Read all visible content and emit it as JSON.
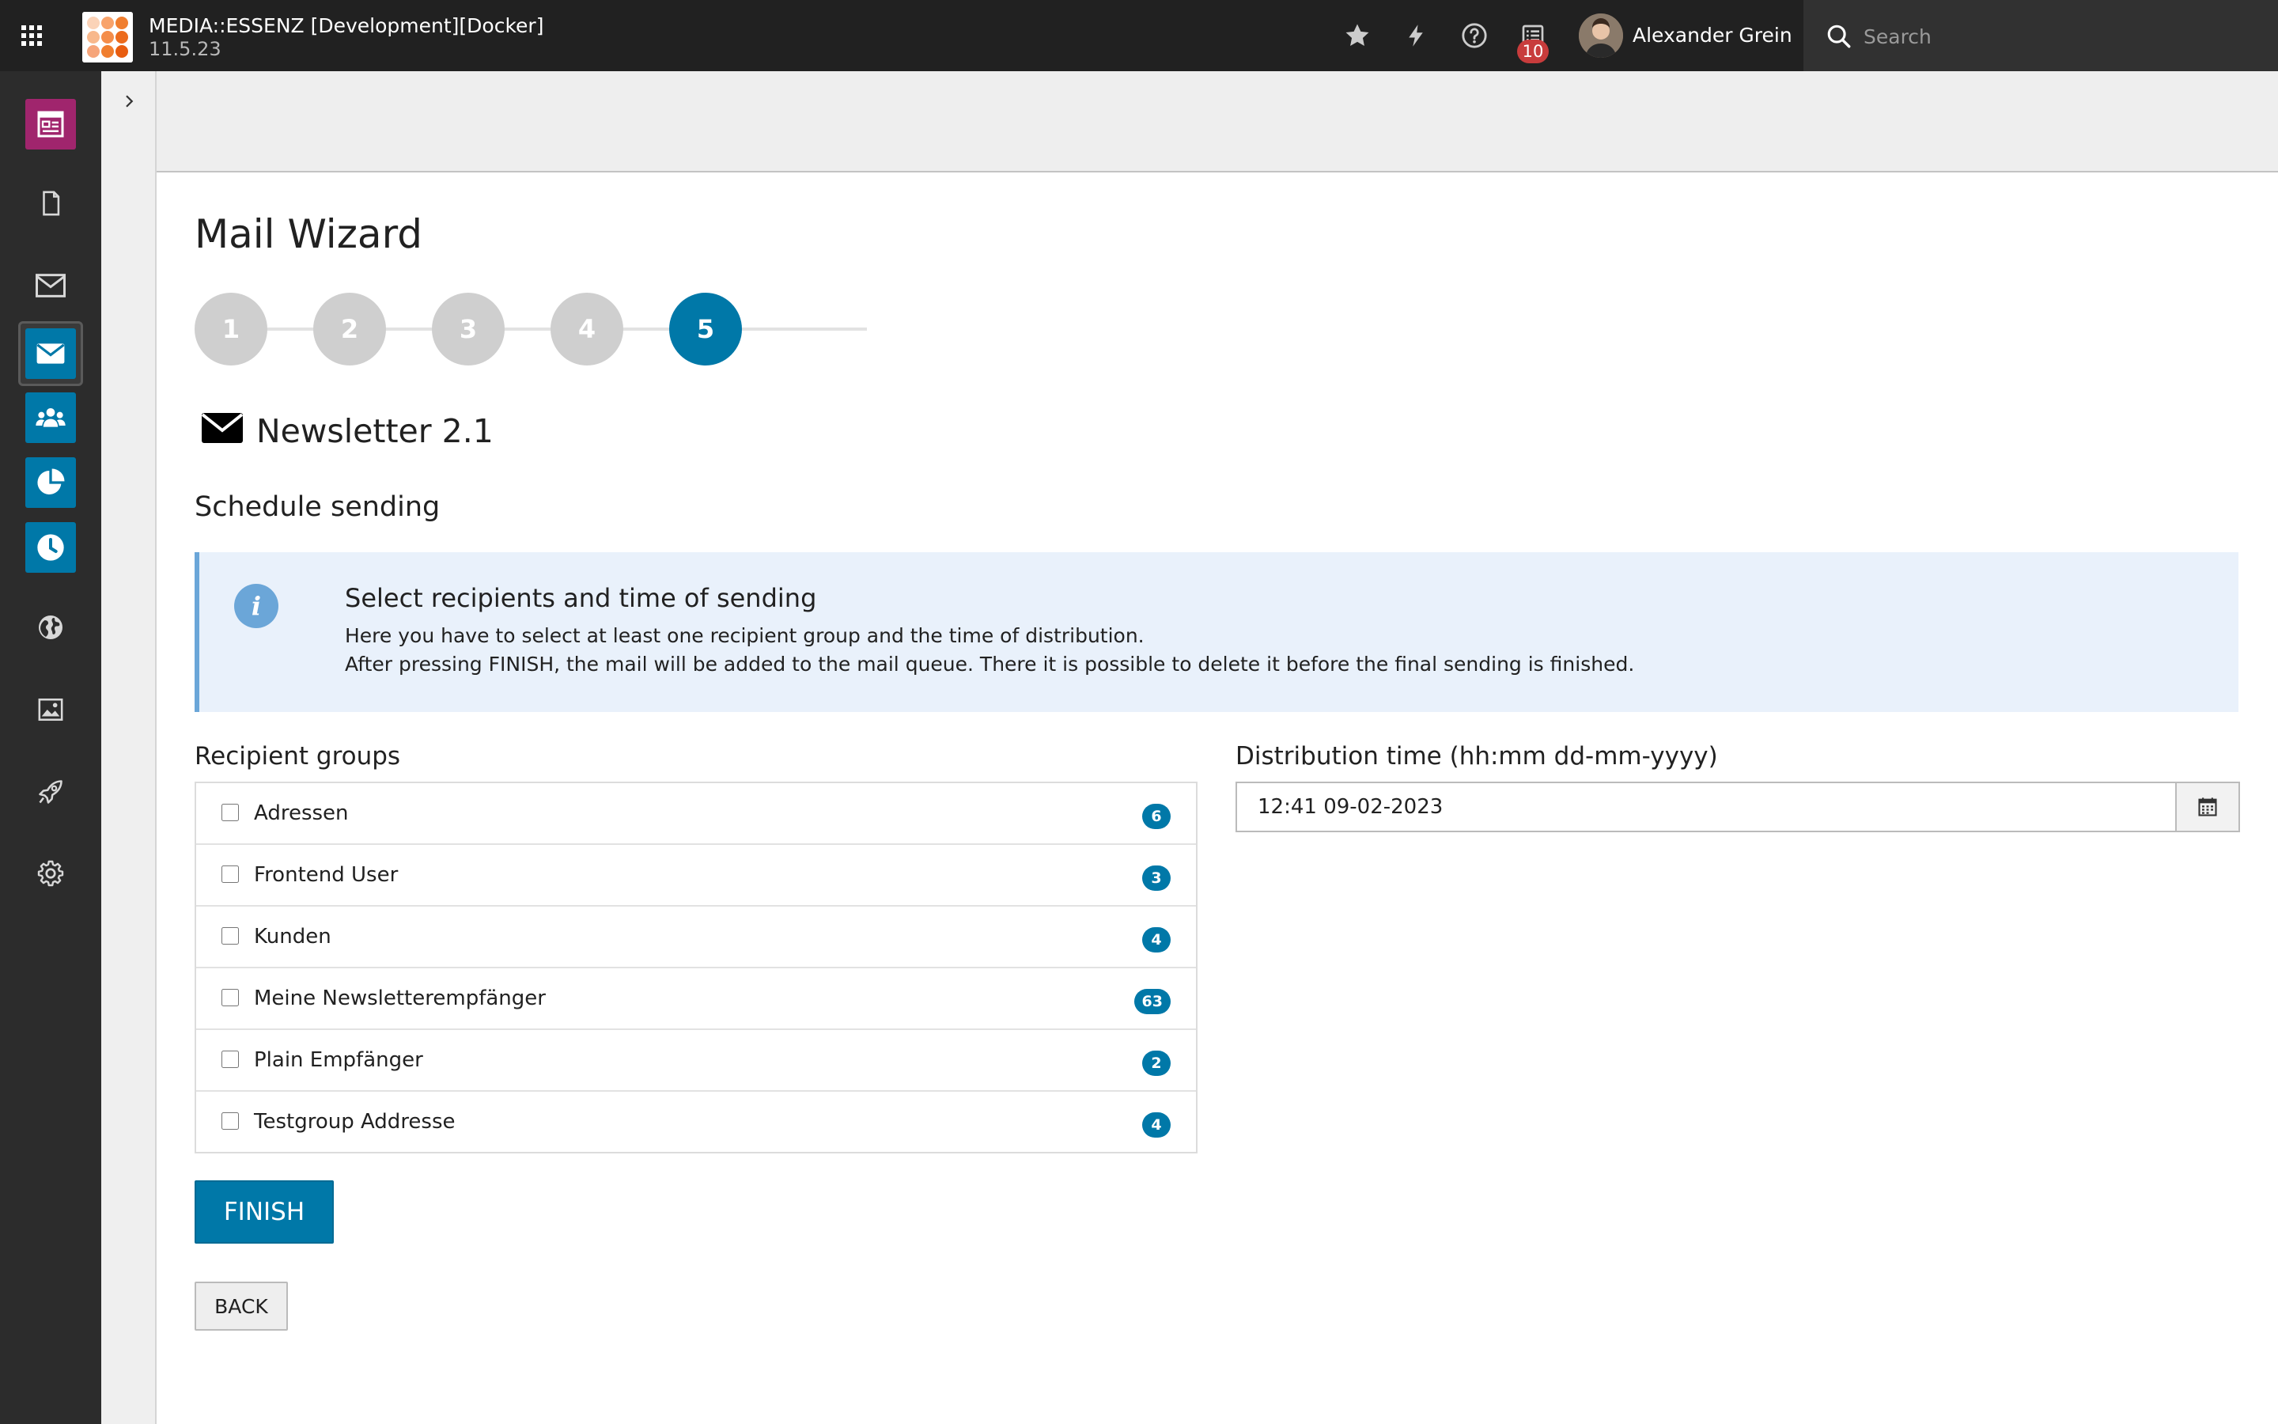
{
  "topbar": {
    "site_name": "MEDIA::ESSENZ [Development][Docker]",
    "version": "11.5.23",
    "notification_count": "10",
    "user_name": "Alexander Grein",
    "search_placeholder": "Search",
    "icons": [
      "app-grid-icon",
      "star-icon",
      "lightning-icon",
      "help-icon",
      "system-info-icon",
      "search-icon"
    ]
  },
  "module_menu": {
    "items": [
      {
        "name": "web-layout-module",
        "color": "#a0256d",
        "active": false
      },
      {
        "name": "page-module",
        "active": false
      },
      {
        "name": "mail-module",
        "active": false
      },
      {
        "name": "mail-wizard-module",
        "color": "#0078a8",
        "active": true
      },
      {
        "name": "recipients-module",
        "color": "#0078a8",
        "active": false
      },
      {
        "name": "report-module",
        "color": "#0078a8",
        "active": false
      },
      {
        "name": "queue-module",
        "color": "#0078a8",
        "active": false
      },
      {
        "name": "globe-module",
        "active": false
      },
      {
        "name": "filelist-module",
        "active": false
      },
      {
        "name": "rocket-module",
        "active": false
      },
      {
        "name": "settings-module",
        "active": false
      }
    ]
  },
  "wizard": {
    "title": "Mail Wizard",
    "steps": [
      "1",
      "2",
      "3",
      "4",
      "5"
    ],
    "current_step": 5,
    "newsletter_title": "Newsletter 2.1",
    "section_title": "Schedule sending",
    "callout": {
      "title": "Select recipients and time of sending",
      "line1": "Here you have to select at least one recipient group and the time of distribution.",
      "line2": "After pressing FINISH, the mail will be added to the mail queue. There it is possible to delete it before the final sending is finished."
    },
    "recipient_groups_label": "Recipient groups",
    "groups": [
      {
        "name": "Adressen",
        "count": "6",
        "checked": false
      },
      {
        "name": "Frontend User",
        "count": "3",
        "checked": false
      },
      {
        "name": "Kunden",
        "count": "4",
        "checked": false
      },
      {
        "name": "Meine Newsletterempfänger",
        "count": "63",
        "checked": false
      },
      {
        "name": "Plain Empfänger",
        "count": "2",
        "checked": false
      },
      {
        "name": "Testgroup Addresse",
        "count": "4",
        "checked": false
      }
    ],
    "distribution_label": "Distribution time (hh:mm dd-mm-yyyy)",
    "distribution_value": "12:41 09-02-2023",
    "finish_label": "FINISH",
    "back_label": "BACK"
  },
  "colors": {
    "topbar": "#212121",
    "sidebar": "#2c2c2c",
    "accent": "#0078a8",
    "web_layout": "#a0256d",
    "callout_bg": "#e9f1fb",
    "notification": "#c83c3c"
  }
}
